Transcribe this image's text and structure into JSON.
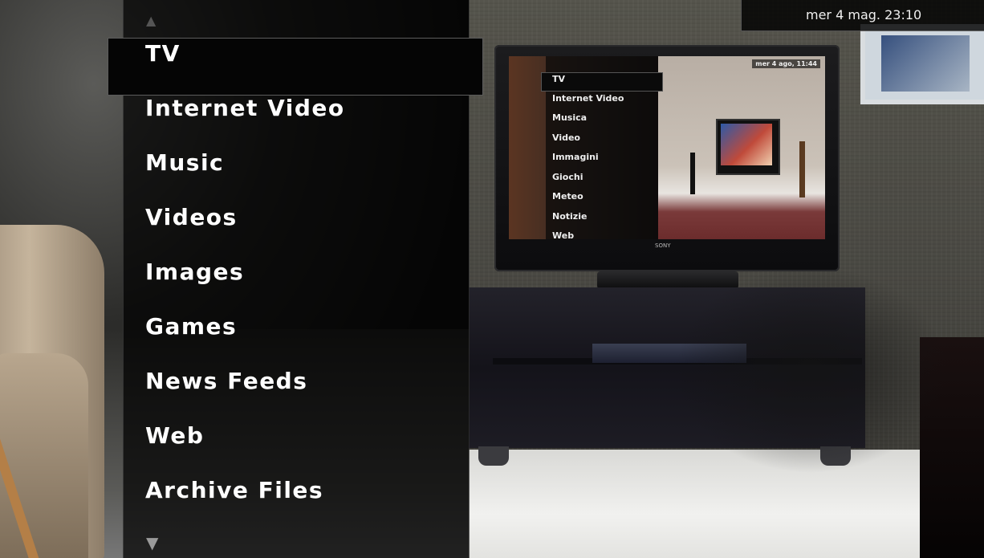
{
  "menu": {
    "items": [
      {
        "label": "TV"
      },
      {
        "label": "Internet Video"
      },
      {
        "label": "Music"
      },
      {
        "label": "Videos"
      },
      {
        "label": "Images"
      },
      {
        "label": "Games"
      },
      {
        "label": "News Feeds"
      },
      {
        "label": "Web"
      },
      {
        "label": "Archive Files"
      }
    ],
    "selected_index": 0,
    "scroll_up_icon": "chevron-up-icon",
    "scroll_down_icon": "chevron-down-icon",
    "scroll_down_glyph": "▼",
    "scroll_up_glyph": "▲"
  },
  "clock": {
    "text": "mer 4 mag. 23:10"
  },
  "background_tv_screen": {
    "clock": "mer 4 ago, 11:44",
    "brand": "SONY",
    "items": [
      "TV",
      "Internet Video",
      "Musica",
      "Video",
      "Immagini",
      "Giochi",
      "Meteo",
      "Notizie",
      "Web"
    ]
  },
  "colors": {
    "menu_text": "#ffffff",
    "panel_bg": "#000000",
    "highlight_border": "#5a5a5a"
  }
}
